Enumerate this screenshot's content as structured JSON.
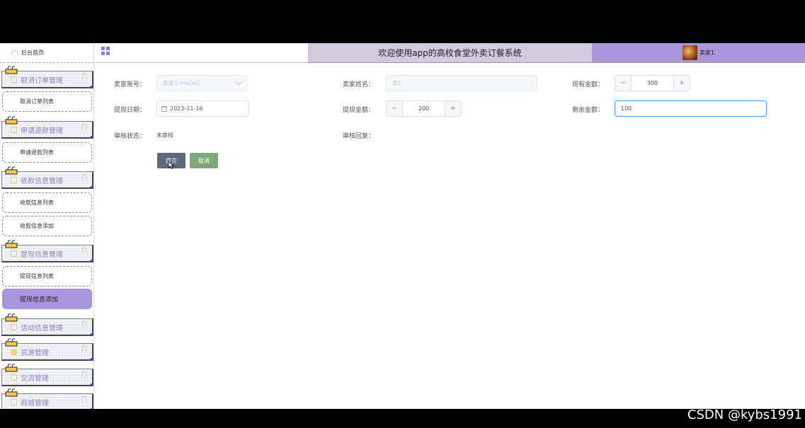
{
  "header": {
    "title": "欢迎使用app的高校食堂外卖订餐系统",
    "user_name": "卖家1"
  },
  "sidebar": {
    "home_label": "后台首页",
    "menus": [
      {
        "label": "取消订单管理",
        "icon": "folder-icon",
        "subs": [
          "取消订单列表"
        ]
      },
      {
        "label": "申请退款管理",
        "icon": "folder-icon",
        "subs": [
          "申请退款列表"
        ]
      },
      {
        "label": "收款信息管理",
        "icon": "folder-icon",
        "subs": [
          "收款信息列表",
          "收款信息添加"
        ]
      },
      {
        "label": "提现信息管理",
        "icon": "folder-icon",
        "subs": [
          "提现信息列表",
          "提现信息添加"
        ]
      },
      {
        "label": "活动信息管理",
        "icon": "folder-icon",
        "subs": []
      },
      {
        "label": "资源管理",
        "icon": "bulb-icon",
        "subs": []
      },
      {
        "label": "交流管理",
        "icon": "chat-icon",
        "subs": []
      },
      {
        "label": "商城管理",
        "icon": "cart-icon",
        "subs": []
      }
    ],
    "active_sub": "提现信息添加"
  },
  "form": {
    "seller_account": {
      "label": "卖家账号：",
      "value": "卖家1-maijia1"
    },
    "seller_name": {
      "label": "卖家姓名：",
      "placeholder": "卖1"
    },
    "current_amount": {
      "label": "现有金额：",
      "value": "300",
      "minus": "−",
      "plus": "+"
    },
    "withdraw_date": {
      "label": "提现日期：",
      "value": "2023-11-16"
    },
    "withdraw_amount": {
      "label": "提现金额：",
      "value": "200",
      "minus": "−",
      "plus": "+"
    },
    "remaining_amount": {
      "label": "剩余金额：",
      "value": "100"
    },
    "review_status": {
      "label": "审核状态：",
      "value": "未审核"
    },
    "review_reply": {
      "label": "审核回复："
    },
    "submit_label": "提交",
    "cancel_label": "取消"
  },
  "watermark": "CSDN @kybs1991",
  "colors": {
    "accent": "#ab96dc",
    "title_bar": "#d2cbde",
    "menu_text": "#8f7ed0",
    "submit": "#5a6a7a",
    "cancel": "#80a878"
  }
}
